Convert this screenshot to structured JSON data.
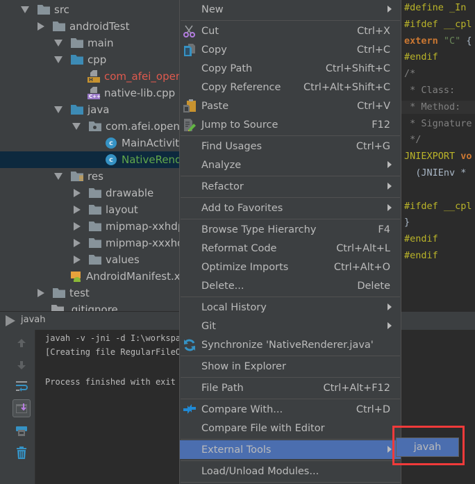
{
  "project_tree": {
    "items": [
      {
        "label": "src",
        "expanded": true,
        "type": "folder"
      },
      {
        "label": "androidTest",
        "expanded": false,
        "type": "folder"
      },
      {
        "label": "main",
        "expanded": true,
        "type": "folder"
      },
      {
        "label": "cpp",
        "expanded": true,
        "type": "source-folder"
      },
      {
        "label": "com_afei_openglsample_NativeRenderer.h",
        "display": "com_afei_open",
        "type": "header-file",
        "badge": "H"
      },
      {
        "label": "native-lib.cpp",
        "type": "cpp-file",
        "badge": "C++"
      },
      {
        "label": "java",
        "expanded": true,
        "type": "source-folder"
      },
      {
        "label": "com.afei.openglsample",
        "display": "com.afei.openg",
        "expanded": true,
        "type": "package"
      },
      {
        "label": "MainActivity",
        "display": "MainActivit",
        "type": "class"
      },
      {
        "label": "NativeRenderer",
        "display": "NativeRend",
        "type": "class",
        "selected": true
      },
      {
        "label": "res",
        "expanded": true,
        "type": "res-folder"
      },
      {
        "label": "drawable",
        "expanded": false,
        "type": "folder"
      },
      {
        "label": "layout",
        "expanded": false,
        "type": "folder"
      },
      {
        "label": "mipmap-xxhdpi",
        "display": "mipmap-xxhdp",
        "expanded": false,
        "type": "folder"
      },
      {
        "label": "mipmap-xxxhdpi",
        "display": "mipmap-xxxhd",
        "expanded": false,
        "type": "folder"
      },
      {
        "label": "values",
        "expanded": false,
        "type": "folder"
      },
      {
        "label": "AndroidManifest.xml",
        "display": "AndroidManifest.x",
        "type": "manifest"
      },
      {
        "label": "test",
        "expanded": false,
        "type": "folder"
      },
      {
        "label": ".gitignore",
        "display": ".gitignore",
        "type": "file"
      }
    ]
  },
  "editor": {
    "lines": [
      {
        "parts": [
          [
            "kw-def",
            "#define "
          ],
          [
            "kw-def",
            "_In"
          ]
        ]
      },
      {
        "parts": [
          [
            "kw-def",
            "#ifdef "
          ],
          [
            "kw-def",
            "__cpl"
          ]
        ]
      },
      {
        "parts": [
          [
            "kw-ext",
            "extern "
          ],
          [
            "str",
            "\"C\" "
          ],
          [
            "ident",
            "{"
          ]
        ]
      },
      {
        "parts": [
          [
            "kw-def",
            "#endif"
          ]
        ]
      },
      {
        "parts": [
          [
            "com",
            "/*"
          ]
        ]
      },
      {
        "parts": [
          [
            "com",
            " * Class:"
          ]
        ]
      },
      {
        "parts": [
          [
            "com",
            " * Method:"
          ]
        ],
        "highlight": true
      },
      {
        "parts": [
          [
            "com",
            " * Signature"
          ]
        ]
      },
      {
        "parts": [
          [
            "com",
            " */"
          ]
        ]
      },
      {
        "parts": [
          [
            "kw-def",
            "JNIEXPORT "
          ],
          [
            "kw-ext",
            "vo"
          ]
        ]
      },
      {
        "parts": [
          [
            "ident",
            "  (JNIEnv *"
          ]
        ]
      },
      {
        "parts": [
          [
            "ident",
            ""
          ]
        ]
      },
      {
        "parts": [
          [
            "kw-def",
            "#ifdef "
          ],
          [
            "kw-def",
            "__cpl"
          ]
        ]
      },
      {
        "parts": [
          [
            "ident",
            "}"
          ]
        ]
      },
      {
        "parts": [
          [
            "kw-def",
            "#endif"
          ]
        ]
      },
      {
        "parts": [
          [
            "kw-def",
            "#endif"
          ]
        ]
      }
    ]
  },
  "run_panel": {
    "tab_label": "javah",
    "console_lines": [
      "javah -v -jni -d I:\\workspace                              m.afei.openglsam",
      "[Creating file RegularFileOb                                \\src\\main\\cpp\\co",
      "",
      "Process finished with exit c"
    ],
    "toolbar": [
      "up-arrow-icon",
      "down-arrow-icon",
      "soft-wrap-icon",
      "scroll-to-end-icon",
      "print-icon",
      "trash-icon"
    ]
  },
  "context_menu": {
    "items": [
      {
        "label": "New",
        "submenu": true
      },
      {
        "separator": true
      },
      {
        "label": "Cut",
        "shortcut": "Ctrl+X",
        "icon": "scissors-icon"
      },
      {
        "label": "Copy",
        "shortcut": "Ctrl+C",
        "icon": "copy-icon"
      },
      {
        "label": "Copy Path",
        "shortcut": "Ctrl+Shift+C"
      },
      {
        "label": "Copy Reference",
        "shortcut": "Ctrl+Alt+Shift+C"
      },
      {
        "label": "Paste",
        "shortcut": "Ctrl+V",
        "icon": "paste-icon"
      },
      {
        "label": "Jump to Source",
        "shortcut": "F12",
        "icon": "edit-source-icon"
      },
      {
        "separator": true
      },
      {
        "label": "Find Usages",
        "shortcut": "Ctrl+G"
      },
      {
        "label": "Analyze",
        "submenu": true
      },
      {
        "separator": true
      },
      {
        "label": "Refactor",
        "submenu": true
      },
      {
        "separator": true
      },
      {
        "label": "Add to Favorites",
        "submenu": true
      },
      {
        "separator": true
      },
      {
        "label": "Browse Type Hierarchy",
        "shortcut": "F4"
      },
      {
        "label": "Reformat Code",
        "shortcut": "Ctrl+Alt+L"
      },
      {
        "label": "Optimize Imports",
        "shortcut": "Ctrl+Alt+O"
      },
      {
        "label": "Delete...",
        "shortcut": "Delete"
      },
      {
        "separator": true
      },
      {
        "label": "Local History",
        "submenu": true
      },
      {
        "label": "Git",
        "submenu": true
      },
      {
        "label": "Synchronize 'NativeRenderer.java'",
        "icon": "sync-icon"
      },
      {
        "separator": true
      },
      {
        "label": "Show in Explorer"
      },
      {
        "separator": true
      },
      {
        "label": "File Path",
        "shortcut": "Ctrl+Alt+F12"
      },
      {
        "separator": true
      },
      {
        "label": "Compare With...",
        "shortcut": "Ctrl+D",
        "icon": "compare-icon"
      },
      {
        "label": "Compare File with Editor"
      },
      {
        "separator": true
      },
      {
        "label": "External Tools",
        "submenu": true,
        "hover": true
      },
      {
        "separator": true
      },
      {
        "label": "Load/Unload Modules..."
      },
      {
        "separator": true
      }
    ]
  },
  "submenu": {
    "items": [
      {
        "label": "javah",
        "hover": true
      }
    ]
  },
  "colors": {
    "menu_hover": "#4b6eaf",
    "annotation_box": "#f03a3a",
    "selected_row": "#0d293e",
    "error_file": "#e05a4e",
    "modified_file": "#62a84b"
  }
}
